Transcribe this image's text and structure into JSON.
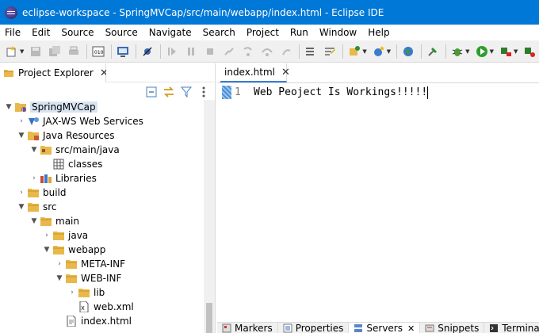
{
  "window": {
    "title": "eclipse-workspace - SpringMVCap/src/main/webapp/index.html - Eclipse IDE"
  },
  "menu": [
    "File",
    "Edit",
    "Source",
    "Source",
    "Navigate",
    "Search",
    "Project",
    "Run",
    "Window",
    "Help"
  ],
  "explorer": {
    "tab_label": "Project Explorer",
    "close": "✕",
    "tree": [
      {
        "label": "SpringMVCap",
        "depth": 0,
        "toggle": "▼",
        "icon": "project-icon",
        "selected": true
      },
      {
        "label": "JAX-WS Web Services",
        "depth": 1,
        "toggle": "›",
        "icon": "web-services-icon"
      },
      {
        "label": "Java Resources",
        "depth": 1,
        "toggle": "▼",
        "icon": "java-resources-icon"
      },
      {
        "label": "src/main/java",
        "depth": 2,
        "toggle": "▼",
        "icon": "package-folder-icon"
      },
      {
        "label": "classes",
        "depth": 3,
        "toggle": "",
        "icon": "classes-icon"
      },
      {
        "label": "Libraries",
        "depth": 2,
        "toggle": "›",
        "icon": "libraries-icon"
      },
      {
        "label": "build",
        "depth": 1,
        "toggle": "›",
        "icon": "folder-icon"
      },
      {
        "label": "src",
        "depth": 1,
        "toggle": "▼",
        "icon": "folder-icon"
      },
      {
        "label": "main",
        "depth": 2,
        "toggle": "▼",
        "icon": "folder-icon"
      },
      {
        "label": "java",
        "depth": 3,
        "toggle": "›",
        "icon": "folder-icon"
      },
      {
        "label": "webapp",
        "depth": 3,
        "toggle": "▼",
        "icon": "folder-icon"
      },
      {
        "label": "META-INF",
        "depth": 4,
        "toggle": "›",
        "icon": "folder-icon"
      },
      {
        "label": "WEB-INF",
        "depth": 4,
        "toggle": "▼",
        "icon": "folder-icon"
      },
      {
        "label": "lib",
        "depth": 5,
        "toggle": "›",
        "icon": "folder-icon"
      },
      {
        "label": "web.xml",
        "depth": 5,
        "toggle": "",
        "icon": "xml-file-icon"
      },
      {
        "label": "index.html",
        "depth": 4,
        "toggle": "",
        "icon": "html-file-icon"
      }
    ]
  },
  "editor": {
    "tab_label": "index.html",
    "close": "✕",
    "line_number": "1",
    "code": "Web Peoject Is Workings!!!!!"
  },
  "bottom_tabs": [
    {
      "label": "Markers",
      "icon": "markers-icon",
      "active": false
    },
    {
      "label": "Properties",
      "icon": "properties-icon",
      "active": false
    },
    {
      "label": "Servers",
      "icon": "servers-icon",
      "active": true,
      "close": "✕"
    },
    {
      "label": "Snippets",
      "icon": "snippets-icon",
      "active": false
    },
    {
      "label": "Terminal",
      "icon": "terminal-icon",
      "active": false
    }
  ],
  "colors": {
    "titlebar": "#0078d7",
    "folder": "#e8b84a",
    "selection": "#d9e4f2",
    "active_tab_border": "#3b7bd0"
  }
}
